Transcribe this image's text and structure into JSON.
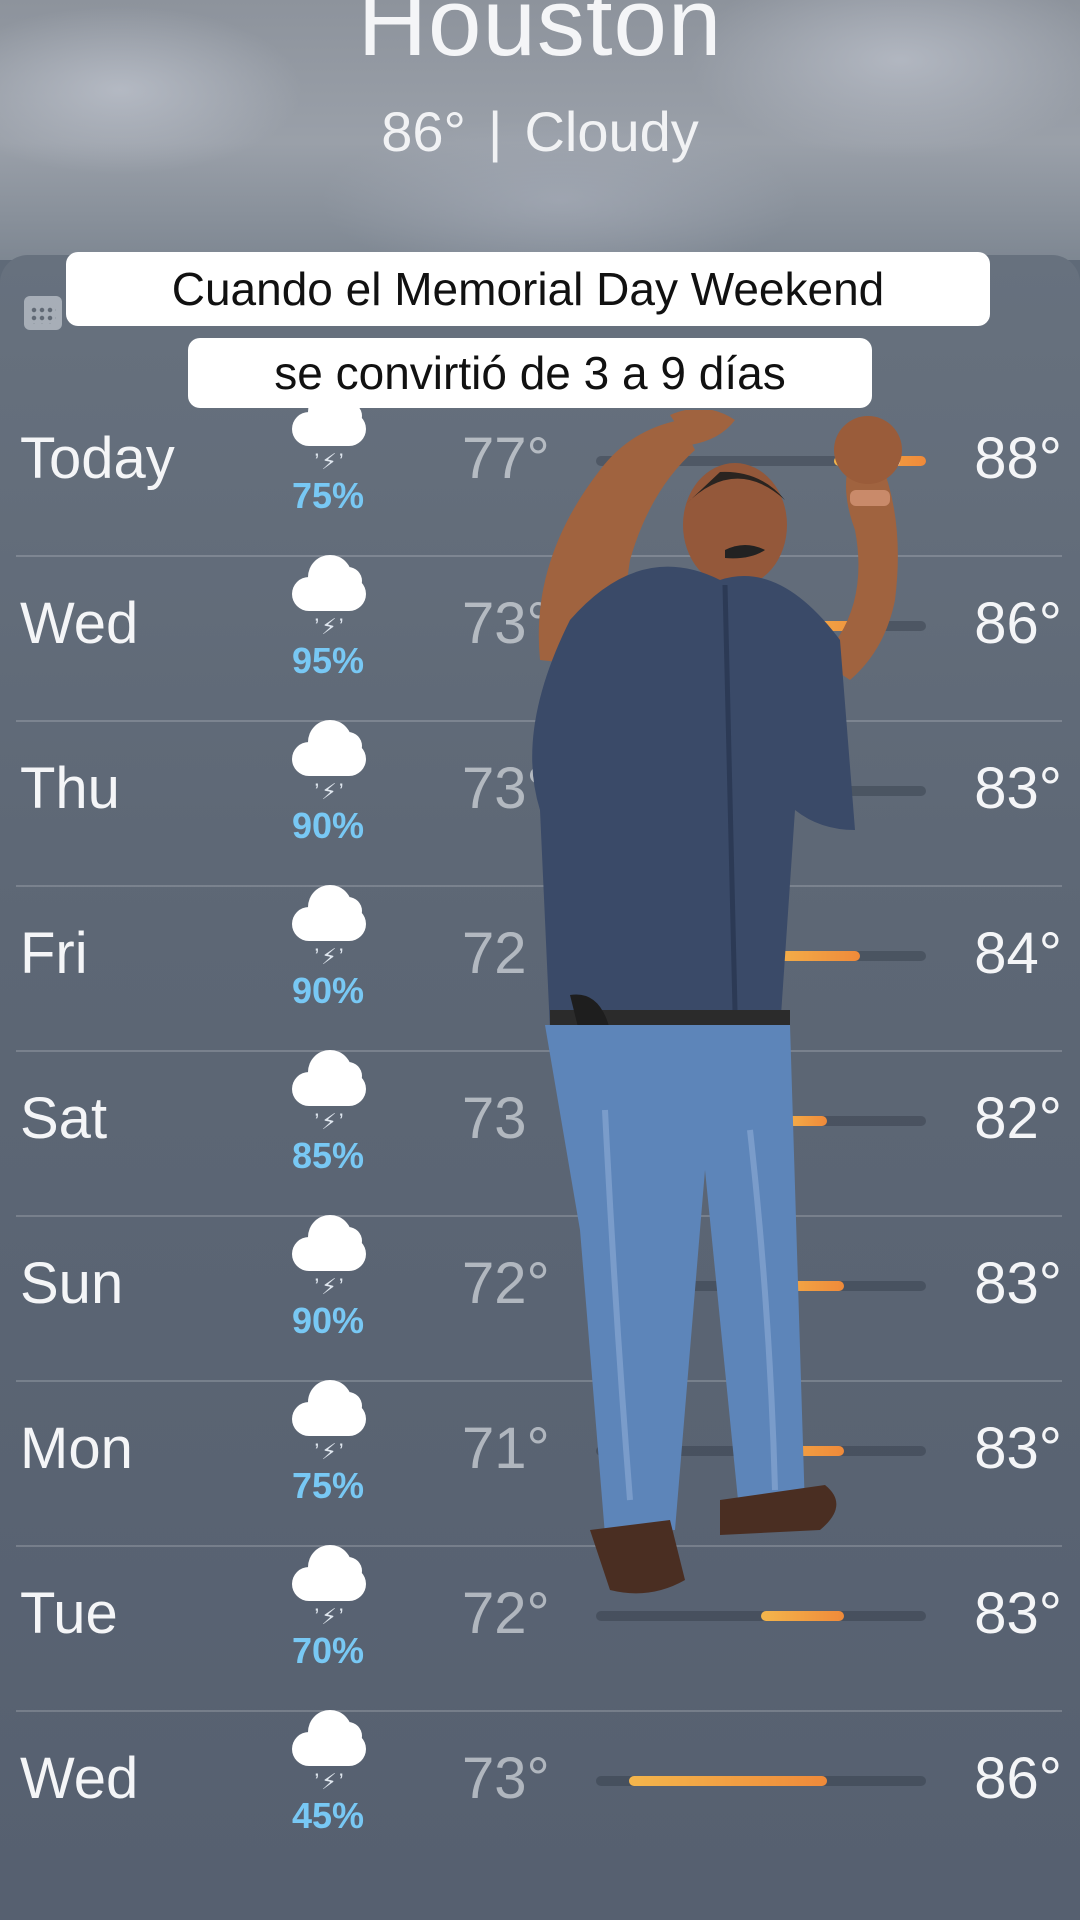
{
  "header": {
    "city": "Houston",
    "temperature": "86°",
    "separator": "|",
    "condition": "Cloudy"
  },
  "caption": {
    "line1": "Cuando el Memorial Day Weekend",
    "line2": "se convirtió de 3 a 9 días"
  },
  "forecast": [
    {
      "day": "Today",
      "precip": "75%",
      "low": "77°",
      "high": "88°",
      "bar_start": 0.72,
      "bar_end": 1.0,
      "current": 0.9
    },
    {
      "day": "Wed",
      "precip": "95%",
      "low": "73°",
      "high": "86°",
      "bar_start": 0.55,
      "bar_end": 0.85
    },
    {
      "day": "Thu",
      "precip": "90%",
      "low": "73°",
      "high": "83°",
      "bar_start": 0.55,
      "bar_end": 0.75
    },
    {
      "day": "Fri",
      "precip": "90%",
      "low": "72",
      "high": "84°",
      "bar_start": 0.5,
      "bar_end": 0.8
    },
    {
      "day": "Sat",
      "precip": "85%",
      "low": "73",
      "high": "82°",
      "bar_start": 0.55,
      "bar_end": 0.7
    },
    {
      "day": "Sun",
      "precip": "90%",
      "low": "72°",
      "high": "83°",
      "bar_start": 0.5,
      "bar_end": 0.75
    },
    {
      "day": "Mon",
      "precip": "75%",
      "low": "71°",
      "high": "83°",
      "bar_start": 0.45,
      "bar_end": 0.75
    },
    {
      "day": "Tue",
      "precip": "70%",
      "low": "72°",
      "high": "83°",
      "bar_start": 0.5,
      "bar_end": 0.75
    },
    {
      "day": "Wed",
      "precip": "45%",
      "low": "73°",
      "high": "86°",
      "bar_start": 0.1,
      "bar_end": 0.7
    }
  ],
  "colors": {
    "precip": "#78c8f4",
    "bar_low": "#f4b64c",
    "bar_high": "#ef8a3a"
  },
  "icons": {
    "weather": "cloud-bolt-rain-icon",
    "calendar": "calendar-icon"
  }
}
